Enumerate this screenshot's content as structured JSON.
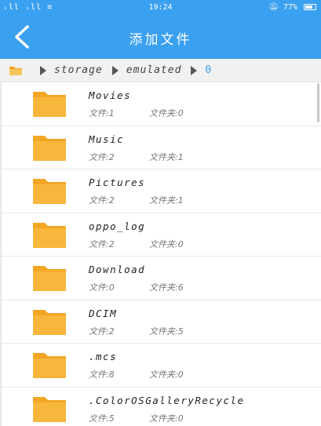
{
  "status_bar": {
    "signal": "ᵢll ᵢll ≋",
    "time": "19:24",
    "alarm_icon": "bell-off-icon",
    "battery": "77%",
    "battery_level": 0.77
  },
  "header": {
    "back_icon": "chevron-left-icon",
    "title": "添加文件"
  },
  "breadcrumb": {
    "folder_icon": "folder-icon",
    "items": [
      "storage",
      "emulated",
      "0"
    ]
  },
  "files": [
    {
      "name": "Movies",
      "files": "文件:1",
      "folders": "文件夹:0"
    },
    {
      "name": "Music",
      "files": "文件:2",
      "folders": "文件夹:1"
    },
    {
      "name": "Pictures",
      "files": "文件:2",
      "folders": "文件夹:1"
    },
    {
      "name": "oppo_log",
      "files": "文件:2",
      "folders": "文件夹:0"
    },
    {
      "name": "Download",
      "files": "文件:0",
      "folders": "文件夹:6"
    },
    {
      "name": "DCIM",
      "files": "文件:2",
      "folders": "文件夹:5"
    },
    {
      "name": ".mcs",
      "files": "文件:8",
      "folders": "文件夹:0"
    },
    {
      "name": ".ColorOSGalleryRecycle",
      "files": "文件:5",
      "folders": "文件夹:0"
    }
  ],
  "colors": {
    "accent": "#3aa0f0",
    "folder": "#f7b73c",
    "folder_back": "#f3a524"
  }
}
